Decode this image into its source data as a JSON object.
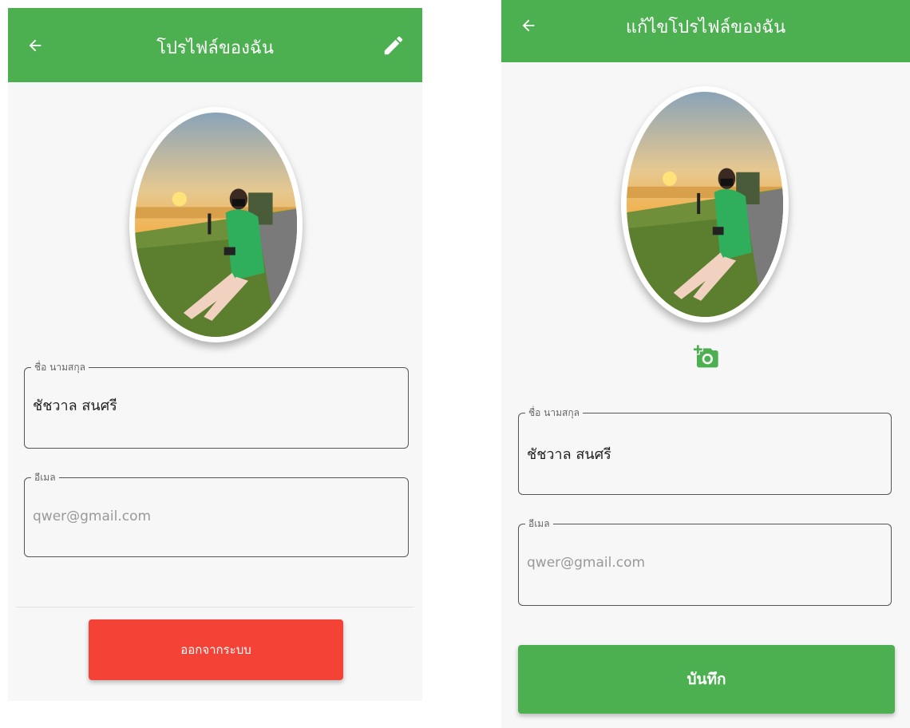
{
  "colors": {
    "accent": "#4caf50",
    "danger": "#f44336",
    "background": "#f7f7f7"
  },
  "profile_screen": {
    "title": "โปรไฟล์ของฉัน",
    "back_icon": "arrow-left-icon",
    "edit_icon": "pencil-icon",
    "name_field": {
      "label": "ชื่อ นามสกุล",
      "value": "ชัชวาล สนศรี"
    },
    "email_field": {
      "label": "อีเมล",
      "placeholder": "qwer@gmail.com"
    },
    "logout_label": "ออกจากระบบ"
  },
  "edit_screen": {
    "title": "แก้ไขโปรไฟล์ของฉัน",
    "back_icon": "arrow-left-icon",
    "add_photo_icon": "add-camera-icon",
    "name_field": {
      "label": "ชื่อ นามสกุล",
      "value": "ชัชวาล สนศรี"
    },
    "email_field": {
      "label": "อีเมล",
      "placeholder": "qwer@gmail.com"
    },
    "save_label": "บันทึก"
  }
}
